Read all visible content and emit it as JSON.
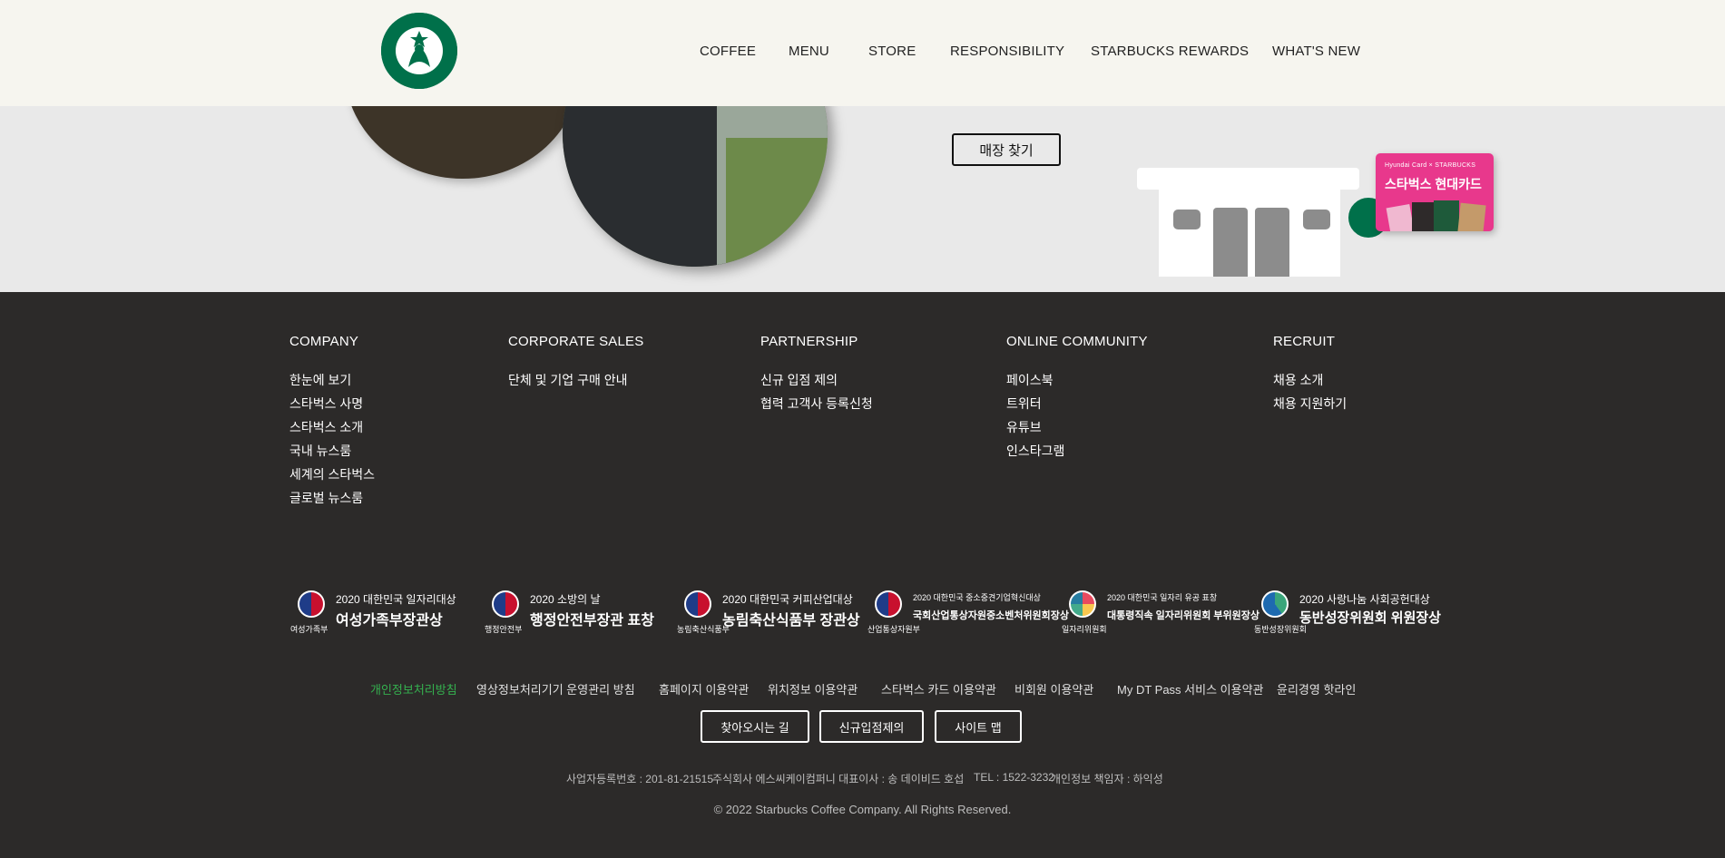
{
  "header": {
    "nav": [
      {
        "label": "COFFEE"
      },
      {
        "label": "MENU"
      },
      {
        "label": "STORE"
      },
      {
        "label": "RESPONSIBILITY"
      },
      {
        "label": "STARBUCKS REWARDS"
      },
      {
        "label": "WHAT'S NEW"
      }
    ]
  },
  "banner": {
    "store_button": "매장 찾기",
    "card": {
      "brand": "Hyundai Card  ×  STARBUCKS",
      "title": "스타벅스 현대카드"
    }
  },
  "footer": {
    "columns": [
      {
        "title": "COMPANY",
        "items": [
          "한눈에 보기",
          "스타벅스 사명",
          "스타벅스 소개",
          "국내 뉴스룸",
          "세계의 스타벅스",
          "글로벌 뉴스룸"
        ]
      },
      {
        "title": "CORPORATE SALES",
        "items": [
          "단체 및 기업 구매 안내"
        ]
      },
      {
        "title": "PARTNERSHIP",
        "items": [
          "신규 입점 제의",
          "협력 고객사 등록신청"
        ]
      },
      {
        "title": "ONLINE COMMUNITY",
        "items": [
          "페이스북",
          "트위터",
          "유튜브",
          "인스타그램"
        ]
      },
      {
        "title": "RECRUIT",
        "items": [
          "채용 소개",
          "채용 지원하기"
        ]
      }
    ],
    "awards": [
      {
        "org": "여성가족부",
        "line1": "2020 대한민국 일자리대상",
        "line2": "여성가족부장관상"
      },
      {
        "org": "행정안전부",
        "line1": "2020 소방의 날",
        "line2": "행정안전부장관 표창"
      },
      {
        "org": "농림축산식품부",
        "line1": "2020 대한민국 커피산업대상",
        "line2": "농림축산식품부 장관상"
      },
      {
        "org": "산업통상자원부",
        "line1": "2020 대한민국 중소중견기업혁신대상",
        "line2": "국회산업통상자원중소벤처위원회장상"
      },
      {
        "org": "일자리위원회",
        "line1": "2020 대한민국 일자리 유공 표창",
        "line2": "대통령직속 일자리위원회 부위원장상"
      },
      {
        "org": "동반성장위원회",
        "line1": "2020 사랑나눔 사회공헌대상",
        "line2": "동반성장위원회 위원장상"
      }
    ],
    "policy_links": [
      "개인정보처리방침",
      "영상정보처리기기 운영관리 방침",
      "홈페이지 이용약관",
      "위치정보 이용약관",
      "스타벅스 카드 이용약관",
      "비회원 이용약관",
      "My DT Pass 서비스 이용약관",
      "윤리경영 핫라인"
    ],
    "buttons": [
      "찾아오시는 길",
      "신규입점제의",
      "사이트 맵"
    ],
    "business_info": [
      "사업자등록번호 : 201-81-21515",
      "주식회사 에스씨케이컴퍼니 대표이사 : 송 데이비드 호섭",
      "TEL : 1522-3232",
      "개인정보 책임자 : 하익성"
    ],
    "copyright": "© 2022 Starbucks Coffee Company. All Rights Reserved."
  },
  "colors": {
    "brand_green": "#00704a",
    "header_bg": "#f6f5ef",
    "footer_bg": "#2c2a29",
    "highlight_link": "#35b04f",
    "card_pink": "#e8388c"
  }
}
